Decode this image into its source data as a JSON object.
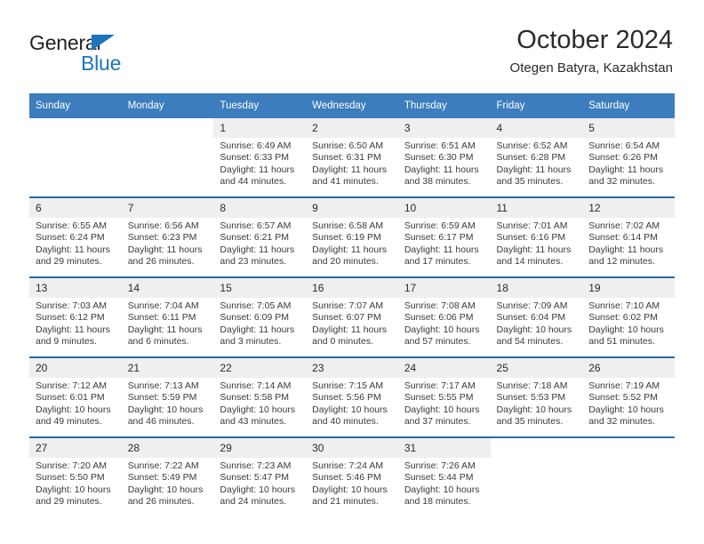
{
  "brand": {
    "name_part1": "General",
    "name_part2": "Blue",
    "triangle_color": "#1b75bb"
  },
  "header": {
    "month_title": "October 2024",
    "location": "Otegen Batyra, Kazakhstan"
  },
  "theme": {
    "header_blue": "#3b7dbd",
    "row_divider_blue": "#2b6cad",
    "daynum_band": "#efefef"
  },
  "calendar": {
    "weekdays": [
      "Sunday",
      "Monday",
      "Tuesday",
      "Wednesday",
      "Thursday",
      "Friday",
      "Saturday"
    ],
    "weeks": [
      [
        {
          "day": "",
          "empty": true
        },
        {
          "day": "",
          "empty": true
        },
        {
          "day": "1",
          "sunrise": "Sunrise: 6:49 AM",
          "sunset": "Sunset: 6:33 PM",
          "daylight_line1": "Daylight: 11 hours",
          "daylight_line2": "and 44 minutes."
        },
        {
          "day": "2",
          "sunrise": "Sunrise: 6:50 AM",
          "sunset": "Sunset: 6:31 PM",
          "daylight_line1": "Daylight: 11 hours",
          "daylight_line2": "and 41 minutes."
        },
        {
          "day": "3",
          "sunrise": "Sunrise: 6:51 AM",
          "sunset": "Sunset: 6:30 PM",
          "daylight_line1": "Daylight: 11 hours",
          "daylight_line2": "and 38 minutes."
        },
        {
          "day": "4",
          "sunrise": "Sunrise: 6:52 AM",
          "sunset": "Sunset: 6:28 PM",
          "daylight_line1": "Daylight: 11 hours",
          "daylight_line2": "and 35 minutes."
        },
        {
          "day": "5",
          "sunrise": "Sunrise: 6:54 AM",
          "sunset": "Sunset: 6:26 PM",
          "daylight_line1": "Daylight: 11 hours",
          "daylight_line2": "and 32 minutes."
        }
      ],
      [
        {
          "day": "6",
          "sunrise": "Sunrise: 6:55 AM",
          "sunset": "Sunset: 6:24 PM",
          "daylight_line1": "Daylight: 11 hours",
          "daylight_line2": "and 29 minutes."
        },
        {
          "day": "7",
          "sunrise": "Sunrise: 6:56 AM",
          "sunset": "Sunset: 6:23 PM",
          "daylight_line1": "Daylight: 11 hours",
          "daylight_line2": "and 26 minutes."
        },
        {
          "day": "8",
          "sunrise": "Sunrise: 6:57 AM",
          "sunset": "Sunset: 6:21 PM",
          "daylight_line1": "Daylight: 11 hours",
          "daylight_line2": "and 23 minutes."
        },
        {
          "day": "9",
          "sunrise": "Sunrise: 6:58 AM",
          "sunset": "Sunset: 6:19 PM",
          "daylight_line1": "Daylight: 11 hours",
          "daylight_line2": "and 20 minutes."
        },
        {
          "day": "10",
          "sunrise": "Sunrise: 6:59 AM",
          "sunset": "Sunset: 6:17 PM",
          "daylight_line1": "Daylight: 11 hours",
          "daylight_line2": "and 17 minutes."
        },
        {
          "day": "11",
          "sunrise": "Sunrise: 7:01 AM",
          "sunset": "Sunset: 6:16 PM",
          "daylight_line1": "Daylight: 11 hours",
          "daylight_line2": "and 14 minutes."
        },
        {
          "day": "12",
          "sunrise": "Sunrise: 7:02 AM",
          "sunset": "Sunset: 6:14 PM",
          "daylight_line1": "Daylight: 11 hours",
          "daylight_line2": "and 12 minutes."
        }
      ],
      [
        {
          "day": "13",
          "sunrise": "Sunrise: 7:03 AM",
          "sunset": "Sunset: 6:12 PM",
          "daylight_line1": "Daylight: 11 hours",
          "daylight_line2": "and 9 minutes."
        },
        {
          "day": "14",
          "sunrise": "Sunrise: 7:04 AM",
          "sunset": "Sunset: 6:11 PM",
          "daylight_line1": "Daylight: 11 hours",
          "daylight_line2": "and 6 minutes."
        },
        {
          "day": "15",
          "sunrise": "Sunrise: 7:05 AM",
          "sunset": "Sunset: 6:09 PM",
          "daylight_line1": "Daylight: 11 hours",
          "daylight_line2": "and 3 minutes."
        },
        {
          "day": "16",
          "sunrise": "Sunrise: 7:07 AM",
          "sunset": "Sunset: 6:07 PM",
          "daylight_line1": "Daylight: 11 hours",
          "daylight_line2": "and 0 minutes."
        },
        {
          "day": "17",
          "sunrise": "Sunrise: 7:08 AM",
          "sunset": "Sunset: 6:06 PM",
          "daylight_line1": "Daylight: 10 hours",
          "daylight_line2": "and 57 minutes."
        },
        {
          "day": "18",
          "sunrise": "Sunrise: 7:09 AM",
          "sunset": "Sunset: 6:04 PM",
          "daylight_line1": "Daylight: 10 hours",
          "daylight_line2": "and 54 minutes."
        },
        {
          "day": "19",
          "sunrise": "Sunrise: 7:10 AM",
          "sunset": "Sunset: 6:02 PM",
          "daylight_line1": "Daylight: 10 hours",
          "daylight_line2": "and 51 minutes."
        }
      ],
      [
        {
          "day": "20",
          "sunrise": "Sunrise: 7:12 AM",
          "sunset": "Sunset: 6:01 PM",
          "daylight_line1": "Daylight: 10 hours",
          "daylight_line2": "and 49 minutes."
        },
        {
          "day": "21",
          "sunrise": "Sunrise: 7:13 AM",
          "sunset": "Sunset: 5:59 PM",
          "daylight_line1": "Daylight: 10 hours",
          "daylight_line2": "and 46 minutes."
        },
        {
          "day": "22",
          "sunrise": "Sunrise: 7:14 AM",
          "sunset": "Sunset: 5:58 PM",
          "daylight_line1": "Daylight: 10 hours",
          "daylight_line2": "and 43 minutes."
        },
        {
          "day": "23",
          "sunrise": "Sunrise: 7:15 AM",
          "sunset": "Sunset: 5:56 PM",
          "daylight_line1": "Daylight: 10 hours",
          "daylight_line2": "and 40 minutes."
        },
        {
          "day": "24",
          "sunrise": "Sunrise: 7:17 AM",
          "sunset": "Sunset: 5:55 PM",
          "daylight_line1": "Daylight: 10 hours",
          "daylight_line2": "and 37 minutes."
        },
        {
          "day": "25",
          "sunrise": "Sunrise: 7:18 AM",
          "sunset": "Sunset: 5:53 PM",
          "daylight_line1": "Daylight: 10 hours",
          "daylight_line2": "and 35 minutes."
        },
        {
          "day": "26",
          "sunrise": "Sunrise: 7:19 AM",
          "sunset": "Sunset: 5:52 PM",
          "daylight_line1": "Daylight: 10 hours",
          "daylight_line2": "and 32 minutes."
        }
      ],
      [
        {
          "day": "27",
          "sunrise": "Sunrise: 7:20 AM",
          "sunset": "Sunset: 5:50 PM",
          "daylight_line1": "Daylight: 10 hours",
          "daylight_line2": "and 29 minutes."
        },
        {
          "day": "28",
          "sunrise": "Sunrise: 7:22 AM",
          "sunset": "Sunset: 5:49 PM",
          "daylight_line1": "Daylight: 10 hours",
          "daylight_line2": "and 26 minutes."
        },
        {
          "day": "29",
          "sunrise": "Sunrise: 7:23 AM",
          "sunset": "Sunset: 5:47 PM",
          "daylight_line1": "Daylight: 10 hours",
          "daylight_line2": "and 24 minutes."
        },
        {
          "day": "30",
          "sunrise": "Sunrise: 7:24 AM",
          "sunset": "Sunset: 5:46 PM",
          "daylight_line1": "Daylight: 10 hours",
          "daylight_line2": "and 21 minutes."
        },
        {
          "day": "31",
          "sunrise": "Sunrise: 7:26 AM",
          "sunset": "Sunset: 5:44 PM",
          "daylight_line1": "Daylight: 10 hours",
          "daylight_line2": "and 18 minutes."
        },
        {
          "day": "",
          "empty": true
        },
        {
          "day": "",
          "empty": true
        }
      ]
    ]
  }
}
